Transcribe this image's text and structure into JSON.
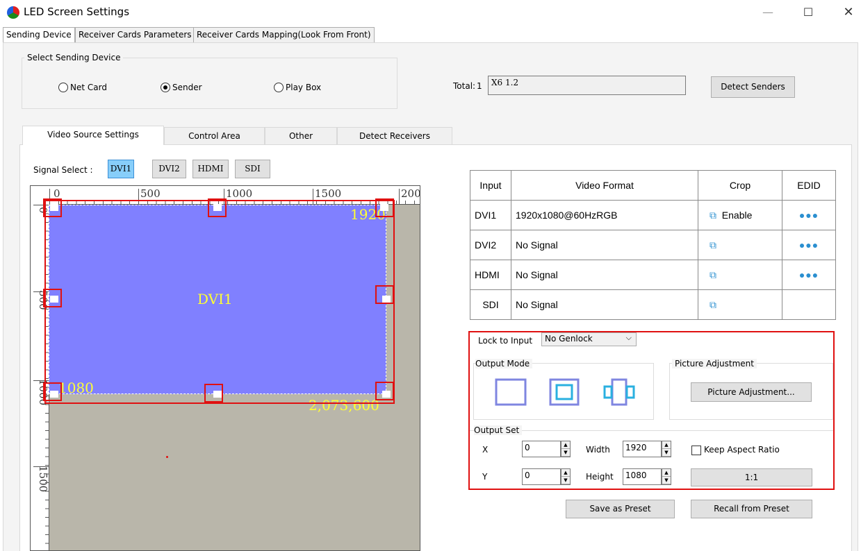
{
  "window": {
    "title": "LED Screen Settings",
    "minimize": "—",
    "maximize": "☐",
    "close": "✕"
  },
  "top_tabs": [
    {
      "label": "Sending Device",
      "active": true
    },
    {
      "label": "Receiver Cards Parameters",
      "active": false
    },
    {
      "label": "Receiver Cards Mapping(Look From Front)",
      "active": false
    }
  ],
  "select_device": {
    "title": "Select Sending Device",
    "options": [
      {
        "label": "Net Card",
        "checked": false
      },
      {
        "label": "Sender",
        "checked": true
      },
      {
        "label": "Play Box",
        "checked": false
      }
    ],
    "total_label": "Total:",
    "total_value": "1",
    "device_value": "X6 1.2",
    "detect_button": "Detect Senders"
  },
  "sub_tabs": [
    {
      "label": "Video Source Settings",
      "active": true
    },
    {
      "label": "Control Area",
      "active": false
    },
    {
      "label": "Other",
      "active": false
    },
    {
      "label": "Detect Receivers",
      "active": false
    }
  ],
  "signal_select": {
    "label": "Signal Select :",
    "buttons": [
      "DVI1",
      "DVI2",
      "HDMI",
      "SDI"
    ],
    "active": "DVI1"
  },
  "canvas": {
    "ruler_h": [
      "0",
      "500",
      "1000",
      "1500",
      "200"
    ],
    "ruler_v": [
      "0",
      "500",
      "1000",
      "1500"
    ],
    "source_label": "DVI1",
    "width_label": "1920",
    "height_label": "1080",
    "area_label": "2,073,600"
  },
  "video_table": {
    "headers": [
      "Input",
      "Video Format",
      "Crop",
      "EDID"
    ],
    "rows": [
      {
        "input": "DVI1",
        "format": "1920x1080@60HzRGB",
        "crop_text": "Enable",
        "edid": true
      },
      {
        "input": "DVI2",
        "format": "No Signal",
        "crop_text": "",
        "edid": true
      },
      {
        "input": "HDMI",
        "format": "No Signal",
        "crop_text": "",
        "edid": true
      },
      {
        "input": "SDI",
        "format": "No Signal",
        "crop_text": "",
        "edid": false
      }
    ],
    "crop_icon": "crop-icon",
    "edid_icon": "more-dots-icon"
  },
  "settings": {
    "lock_label": "Lock to Input",
    "lock_value": "No Genlock",
    "output_mode_label": "Output Mode",
    "picture_adjust_group": "Picture Adjustment",
    "picture_adjust_button": "Picture Adjustment...",
    "output_set_label": "Output Set",
    "x_label": "X",
    "x_value": "0",
    "y_label": "Y",
    "y_value": "0",
    "width_label": "Width",
    "width_value": "1920",
    "height_label": "Height",
    "height_value": "1080",
    "keep_aspect_label": "Keep Aspect Ratio",
    "keep_aspect_checked": false,
    "ratio_button": "1:1"
  },
  "presets": {
    "save": "Save as Preset",
    "recall": "Recall from Preset"
  },
  "colors": {
    "video_fill": "#8080ff",
    "selection_red": "#e01010",
    "canvas_bg": "#b9b6aa",
    "active_signal": "#87cefa",
    "label_yellow": "#ffff33"
  }
}
